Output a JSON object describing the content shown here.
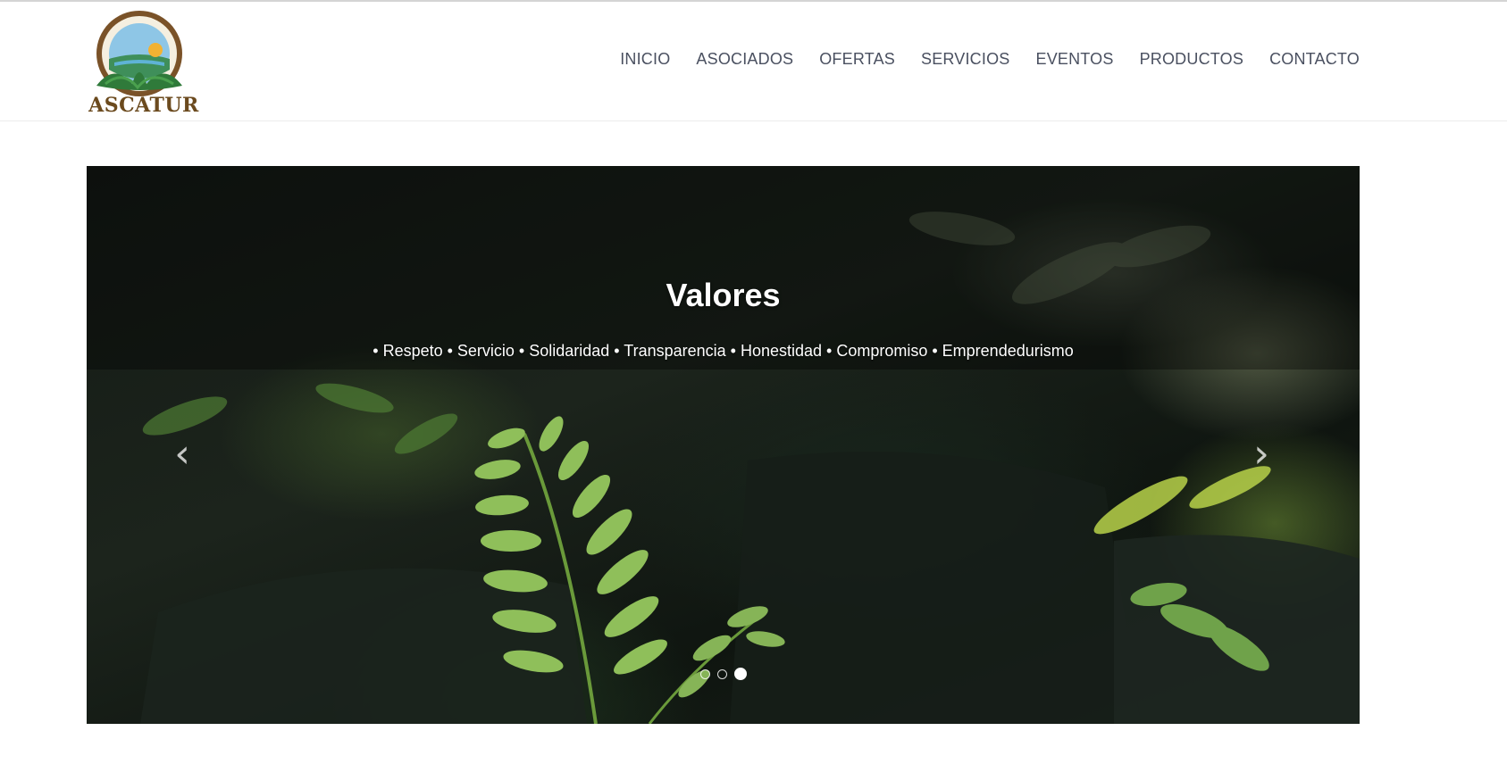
{
  "logo": {
    "text": "ASCATUR"
  },
  "nav": {
    "items": [
      {
        "label": "INICIO"
      },
      {
        "label": "ASOCIADOS"
      },
      {
        "label": "OFERTAS"
      },
      {
        "label": "SERVICIOS"
      },
      {
        "label": "EVENTOS"
      },
      {
        "label": "PRODUCTOS"
      },
      {
        "label": "CONTACTO"
      }
    ]
  },
  "carousel": {
    "title": "Valores",
    "text": "• Respeto • Servicio • Solidaridad • Transparencia • Honestidad • Compromiso • Emprendedurismo",
    "prev_icon": "chevron-left-icon",
    "next_icon": "chevron-right-icon",
    "slide_count": 3,
    "active_index": 2
  },
  "colors": {
    "nav_text": "#4a5060",
    "logo_brown": "#6b4a1e"
  }
}
